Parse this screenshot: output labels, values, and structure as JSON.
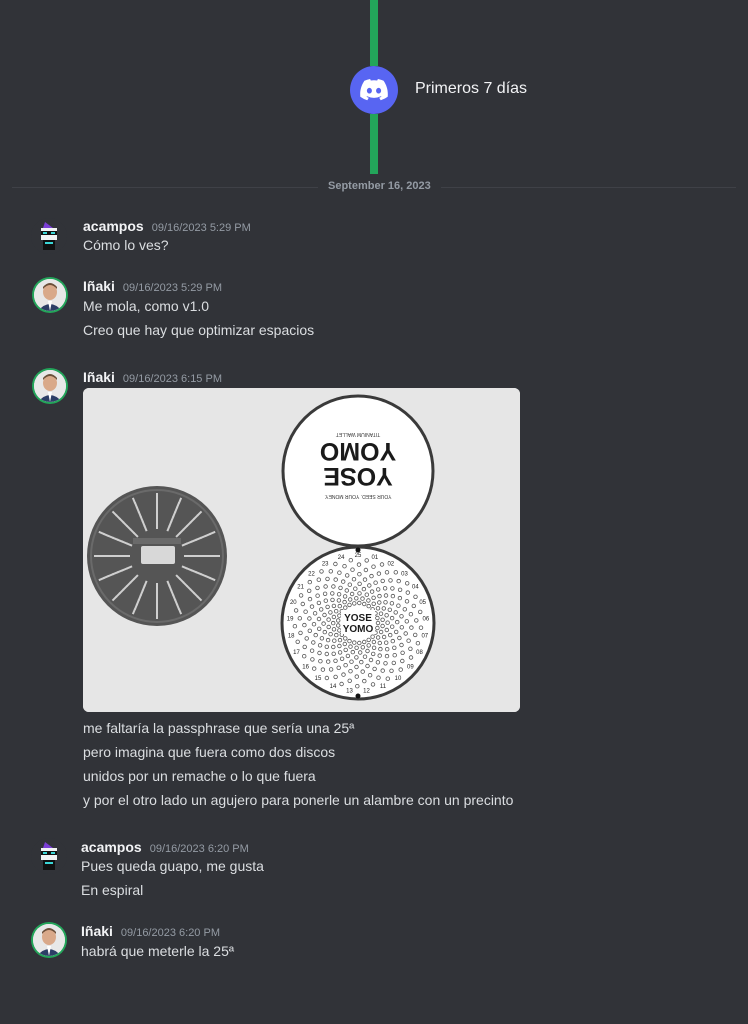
{
  "milestone": {
    "label": "Primeros 7 días"
  },
  "divider": {
    "date": "September 16, 2023"
  },
  "messages": [
    {
      "username": "acampos",
      "timestamp": "09/16/2023 5:29 PM",
      "lines": [
        "Cómo lo ves?"
      ]
    },
    {
      "username": "Iñaki",
      "timestamp": "09/16/2023 5:29 PM",
      "lines": [
        "Me mola, como v1.0",
        "Creo que hay que optimizar espacios"
      ]
    },
    {
      "username": "Iñaki",
      "timestamp": "09/16/2023 6:15 PM",
      "lines": [
        "me faltaría la passphrase que sería una 25ª",
        "pero imagina que fuera como dos discos",
        "unidos por un remache o lo que fuera",
        "y por el otro lado un agujero para ponerle un alambre con un precinto"
      ]
    },
    {
      "username": "acampos",
      "timestamp": "09/16/2023 6:20 PM",
      "lines": [
        "Pues queda guapo, me gusta",
        "En espiral"
      ]
    },
    {
      "username": "Iñaki",
      "timestamp": "09/16/2023 6:20 PM",
      "lines": [
        "habrá que meterle la 25ª"
      ]
    }
  ],
  "attachment": {
    "logo_line1": "YOSE",
    "logo_line2": "YOMO",
    "tagline_top": "YOUR SEED. YOUR MONEY.",
    "tagline_bottom": "TITANIUM WALLET",
    "numbers": [
      "25",
      "24",
      "23",
      "22",
      "21",
      "20",
      "19",
      "18",
      "17",
      "16",
      "15",
      "14",
      "13",
      "12",
      "11",
      "10",
      "09",
      "08",
      "07",
      "06",
      "05",
      "04",
      "03",
      "02",
      "01"
    ]
  },
  "colors": {
    "background": "#313338",
    "timeline": "#23a55a",
    "blurple": "#5865f2"
  }
}
